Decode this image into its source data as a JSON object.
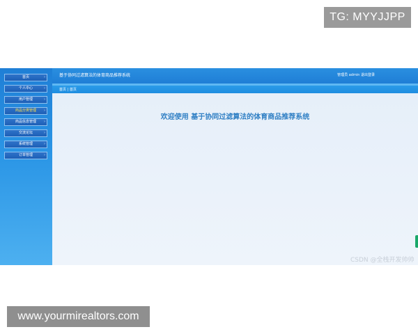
{
  "watermarks": {
    "top": "TG: MYYJJPP",
    "bottom": "www.yourmirealtors.com",
    "corner": "CSDN @全栈开发帅帅"
  },
  "header": {
    "title": "基于协同过滤算法的体育商品推荐系统",
    "user_text": "管理员 admin  退出登录"
  },
  "breadcrumb": {
    "home": "首页",
    "separator": "|",
    "current": "首页"
  },
  "sidebar": {
    "items": [
      {
        "label": "首页"
      },
      {
        "label": "个人中心"
      },
      {
        "label": "用户管理"
      },
      {
        "label": "商品分类管理"
      },
      {
        "label": "商品信息管理"
      },
      {
        "label": "交流论坛"
      },
      {
        "label": "系统管理"
      },
      {
        "label": "订单管理"
      }
    ]
  },
  "main": {
    "welcome": "欢迎使用 基于协同过滤算法的体育商品推荐系统"
  },
  "colors": {
    "sidebar": "#2b96e6",
    "header": "#1f7ed6",
    "accent_text": "#2f7fc4",
    "active_item": "#ffe04a"
  }
}
